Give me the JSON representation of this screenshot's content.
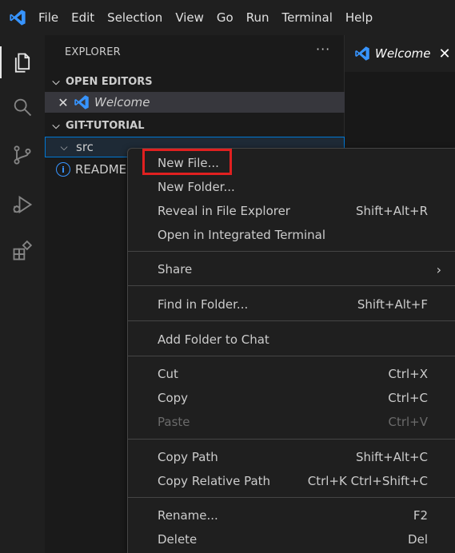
{
  "menubar": {
    "items": [
      "File",
      "Edit",
      "Selection",
      "View",
      "Go",
      "Run",
      "Terminal",
      "Help"
    ]
  },
  "activitybar": {
    "icons": [
      "files-icon",
      "search-icon",
      "source-control-icon",
      "run-debug-icon",
      "extensions-icon"
    ]
  },
  "sidebar": {
    "title": "EXPLORER",
    "more": "···",
    "open_editors": {
      "heading": "OPEN EDITORS",
      "items": [
        {
          "label": "Welcome"
        }
      ]
    },
    "workspace": {
      "heading": "GIT-TUTORIAL",
      "items": [
        {
          "label": "src",
          "type": "folder"
        },
        {
          "label": "README.",
          "type": "file"
        }
      ]
    }
  },
  "editor": {
    "tab": {
      "label": "Welcome"
    }
  },
  "context_menu": {
    "groups": [
      [
        {
          "label": "New File...",
          "shortcut": ""
        },
        {
          "label": "New Folder...",
          "shortcut": ""
        },
        {
          "label": "Reveal in File Explorer",
          "shortcut": "Shift+Alt+R"
        },
        {
          "label": "Open in Integrated Terminal",
          "shortcut": ""
        }
      ],
      [
        {
          "label": "Share",
          "shortcut": "",
          "submenu": "›"
        }
      ],
      [
        {
          "label": "Find in Folder...",
          "shortcut": "Shift+Alt+F"
        }
      ],
      [
        {
          "label": "Add Folder to Chat",
          "shortcut": ""
        }
      ],
      [
        {
          "label": "Cut",
          "shortcut": "Ctrl+X"
        },
        {
          "label": "Copy",
          "shortcut": "Ctrl+C"
        },
        {
          "label": "Paste",
          "shortcut": "Ctrl+V",
          "disabled": true
        }
      ],
      [
        {
          "label": "Copy Path",
          "shortcut": "Shift+Alt+C"
        },
        {
          "label": "Copy Relative Path",
          "shortcut": "Ctrl+K Ctrl+Shift+C"
        }
      ],
      [
        {
          "label": "Rename...",
          "shortcut": "F2"
        },
        {
          "label": "Delete",
          "shortcut": "Del"
        }
      ]
    ]
  },
  "colors": {
    "accent": "#0078d4",
    "highlight": "#e02020",
    "vscode_blue": "#3794ff"
  }
}
